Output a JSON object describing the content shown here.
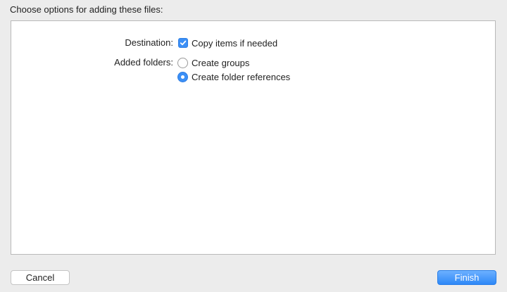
{
  "header": {
    "title": "Choose options for adding these files:"
  },
  "options": {
    "destination": {
      "label": "Destination:",
      "checkbox": {
        "label": "Copy items if needed",
        "checked": true
      }
    },
    "added_folders": {
      "label": "Added folders:",
      "choices": [
        {
          "label": "Create groups",
          "selected": false
        },
        {
          "label": "Create folder references",
          "selected": true
        }
      ]
    }
  },
  "footer": {
    "cancel_label": "Cancel",
    "finish_label": "Finish"
  },
  "colors": {
    "accent": "#3b8ff6",
    "window_bg": "#ececec",
    "panel_bg": "#ffffff"
  }
}
